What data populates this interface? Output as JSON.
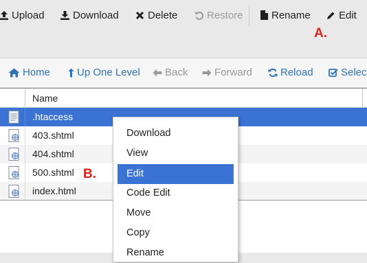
{
  "toolbar": {
    "upload": "Upload",
    "download": "Download",
    "delete": "Delete",
    "restore": "Restore",
    "rename": "Rename",
    "edit": "Edit"
  },
  "markers": {
    "a": "A.",
    "b": "B."
  },
  "navbar": {
    "home": "Home",
    "up_one_level": "Up One Level",
    "back": "Back",
    "forward": "Forward",
    "reload": "Reload",
    "select": "Select"
  },
  "table": {
    "header_name": "Name",
    "rows": [
      {
        "name": ".htaccess"
      },
      {
        "name": "403.shtml"
      },
      {
        "name": "404.shtml"
      },
      {
        "name": "500.shtml"
      },
      {
        "name": "index.html"
      }
    ]
  },
  "context_menu": {
    "items": [
      "Download",
      "View",
      "Edit",
      "Code Edit",
      "Move",
      "Copy",
      "Rename"
    ],
    "active": "Edit"
  },
  "colors": {
    "selection": "#3a73d4",
    "link": "#2f73b5",
    "marker": "#d9261c"
  }
}
